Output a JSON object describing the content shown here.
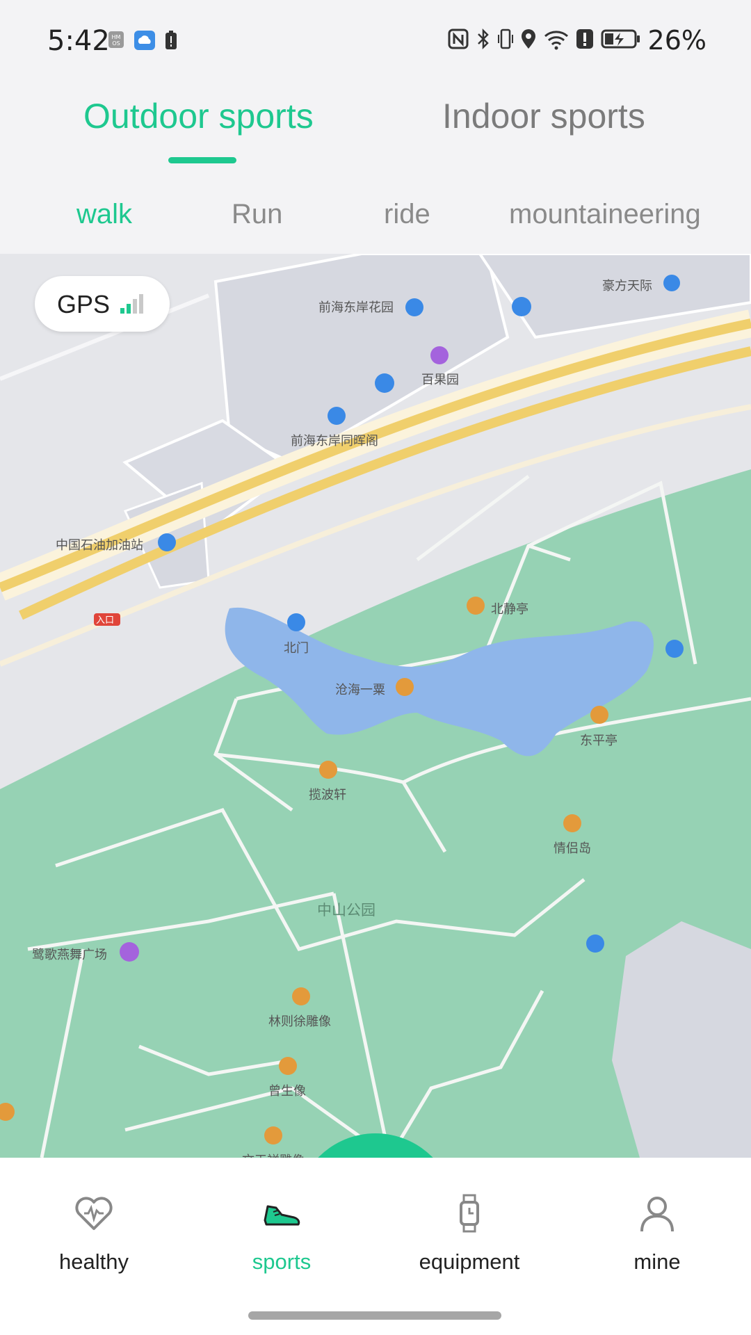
{
  "status_bar": {
    "time": "5:42",
    "battery_percent": "26%",
    "left_icons": [
      "hmos-icon",
      "cloud-icon",
      "alert-icon"
    ],
    "right_icons": [
      "nfc-icon",
      "bluetooth-icon",
      "vibrate-icon",
      "location-icon",
      "wifi-icon",
      "alert-icon",
      "battery-charging-icon"
    ]
  },
  "main_tabs": [
    {
      "label": "Outdoor sports",
      "active": true
    },
    {
      "label": "Indoor sports",
      "active": false
    }
  ],
  "sub_tabs": [
    {
      "label": "walk",
      "active": true
    },
    {
      "label": "Run",
      "active": false
    },
    {
      "label": "ride",
      "active": false
    },
    {
      "label": "mountaineering",
      "active": false
    }
  ],
  "map": {
    "gps_label": "GPS",
    "gps_signal_bars": "2 of 4",
    "labels": [
      "前海东岸花园",
      "豪方天际",
      "百果园",
      "前海东岸同晖阁",
      "中国石油加油站",
      "入口",
      "北门",
      "北静亭",
      "沧海一粟",
      "东平亭",
      "揽波轩",
      "情侣岛",
      "中山公园",
      "鹭歌燕舞广场",
      "林则徐雕像",
      "曾生像",
      "文天祥雕像"
    ]
  },
  "bottom_nav": [
    {
      "label": "healthy",
      "icon": "heart-pulse-icon",
      "active": false
    },
    {
      "label": "sports",
      "icon": "sneaker-icon",
      "active": true
    },
    {
      "label": "equipment",
      "icon": "watch-icon",
      "active": false
    },
    {
      "label": "mine",
      "icon": "person-icon",
      "active": false
    }
  ],
  "colors": {
    "accent": "#1ec88f",
    "inactive": "#7b7b7b",
    "park": "#96d2b4",
    "water": "#8fb6ea",
    "road": "#f0cf6c"
  }
}
